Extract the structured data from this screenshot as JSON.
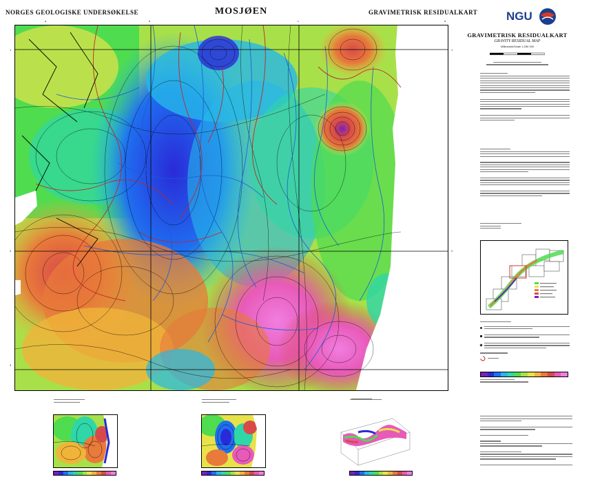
{
  "header": {
    "left": "NORGES GEOLOGISKE UNDERSØKELSE",
    "center": "MOSJØEN",
    "right": "GRAVIMETRISK RESIDUALKART"
  },
  "logo": {
    "text": "NGU",
    "color": "#1b3f8c",
    "accent": "#d43a2a"
  },
  "panel": {
    "title": "GRAVIMETRISK RESIDUALKART",
    "subtitle": "GRAVITY RESIDUAL MAP",
    "scale": "Målestokk/Scale 1:250 000"
  },
  "map": {
    "grid_labels_top": [
      "a",
      "b",
      "c",
      "d",
      "e"
    ],
    "grid_labels_left": [
      "1",
      "2",
      "3",
      "4"
    ]
  },
  "colors": {
    "ramp": [
      "#7a1fb8",
      "#2a2ad8",
      "#1f6ff0",
      "#26b7e8",
      "#2fd6a8",
      "#4fdc4f",
      "#a8e04a",
      "#e8e24a",
      "#f0b43a",
      "#e87a3a",
      "#d84a4a",
      "#e85ab8",
      "#f07ee0"
    ],
    "contour": "#000000",
    "geology_lines": "#c0262b",
    "rivers": "#1c5ad4"
  }
}
